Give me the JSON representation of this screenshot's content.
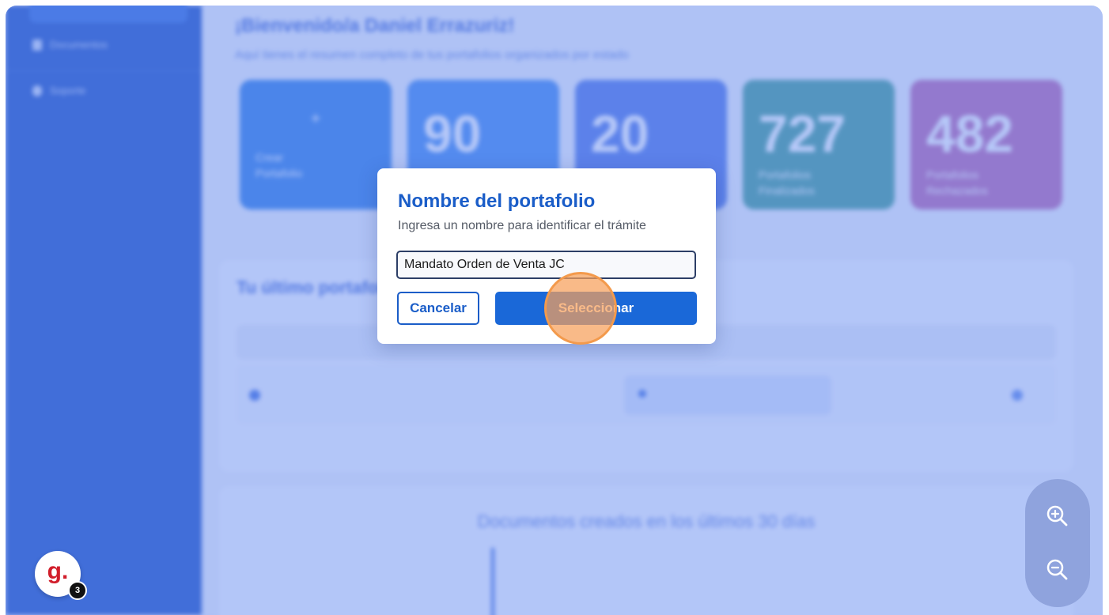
{
  "background_app": {
    "sidebar": {
      "items": [
        {
          "label": "Documentos",
          "icon": "document-icon"
        },
        {
          "label": "Soporte",
          "icon": "support-icon"
        }
      ]
    },
    "welcome_title": "¡Bienvenido/a Daniel Errazuriz!",
    "welcome_subtitle": "Aquí tienes el resumen completo de tus portafolios organizados por estado",
    "cards": [
      {
        "value": "+",
        "label": "Crear Portafolio",
        "color": "#3d86e6"
      },
      {
        "value": "90",
        "label": "",
        "color": "#4d90ee"
      },
      {
        "value": "20",
        "label": "",
        "color": "#5b7fe6"
      },
      {
        "value": "727",
        "label": "Portafolios Finalizados",
        "color": "#4ea39a"
      },
      {
        "value": "482",
        "label": "Portafolios Rechazados",
        "color": "#c06fb2"
      }
    ],
    "last_section_title": "Tu último portafolio",
    "chart_title": "Documentos creados en los últimos 30 días"
  },
  "modal": {
    "title": "Nombre del portafolio",
    "subtitle": "Ingresa un nombre para identificar el trámite",
    "input_value": "Mandato Orden de Venta JC",
    "cancel_label": "Cancelar",
    "select_label": "Seleccionar"
  },
  "zoom": {
    "in_icon": "zoom-in-icon",
    "out_icon": "zoom-out-icon"
  },
  "avatar": {
    "letter": "g.",
    "badge_count": "3"
  },
  "colors": {
    "accent": "#1a5dc8",
    "button": "#1a68d8",
    "click_highlight": "#f39a4c"
  }
}
